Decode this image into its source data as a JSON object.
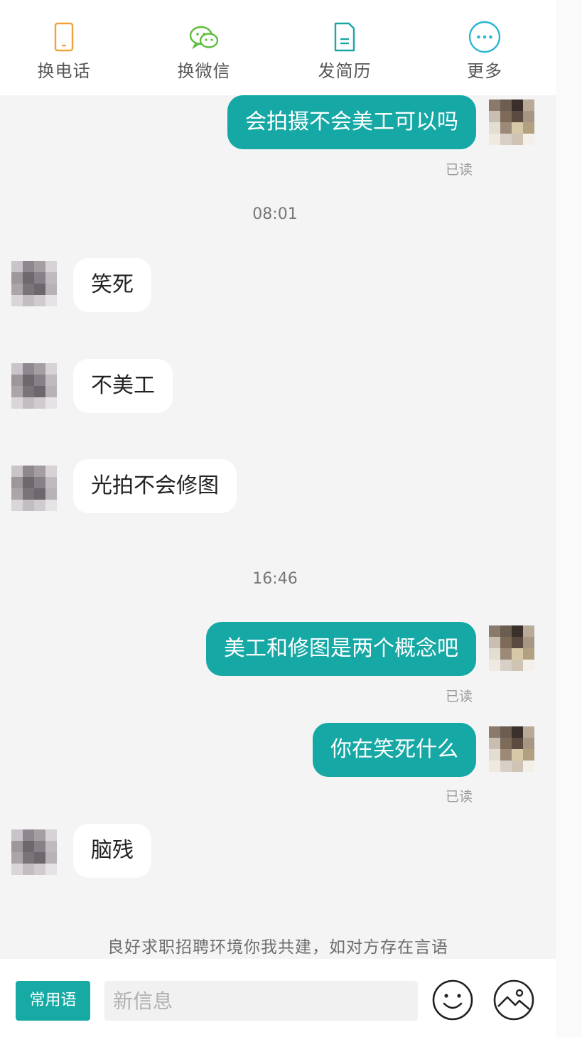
{
  "topbar": {
    "actions": [
      {
        "label": "换电话",
        "icon": "phone-icon",
        "color": "#f0a33a"
      },
      {
        "label": "换微信",
        "icon": "wechat-icon",
        "color": "#5dbd3c"
      },
      {
        "label": "发简历",
        "icon": "resume-icon",
        "color": "#19a7a4"
      },
      {
        "label": "更多",
        "icon": "more-icon",
        "color": "#2ab6d4"
      }
    ]
  },
  "chat": {
    "messages": [
      {
        "text": "会拍摄不会美工可以吗",
        "side": "out",
        "status": "已读"
      },
      {
        "time": "08:01"
      },
      {
        "text": "笑死",
        "side": "in"
      },
      {
        "text": "不美工",
        "side": "in"
      },
      {
        "text": "光拍不会修图",
        "side": "in"
      },
      {
        "time": "16:46"
      },
      {
        "text": "美工和修图是两个概念吧",
        "side": "out",
        "status": "已读"
      },
      {
        "text": "你在笑死什么",
        "side": "out",
        "status": "已读"
      },
      {
        "text": "脑残",
        "side": "in"
      }
    ],
    "notice": "良好求职招聘环境你我共建，如对方存在言语"
  },
  "inputbar": {
    "phrases_label": "常用语",
    "placeholder": "新信息",
    "emoji_icon": "emoji-icon",
    "image_icon": "image-icon"
  },
  "colors": {
    "accent": "#16a8a5",
    "background": "#f4f4f4"
  }
}
